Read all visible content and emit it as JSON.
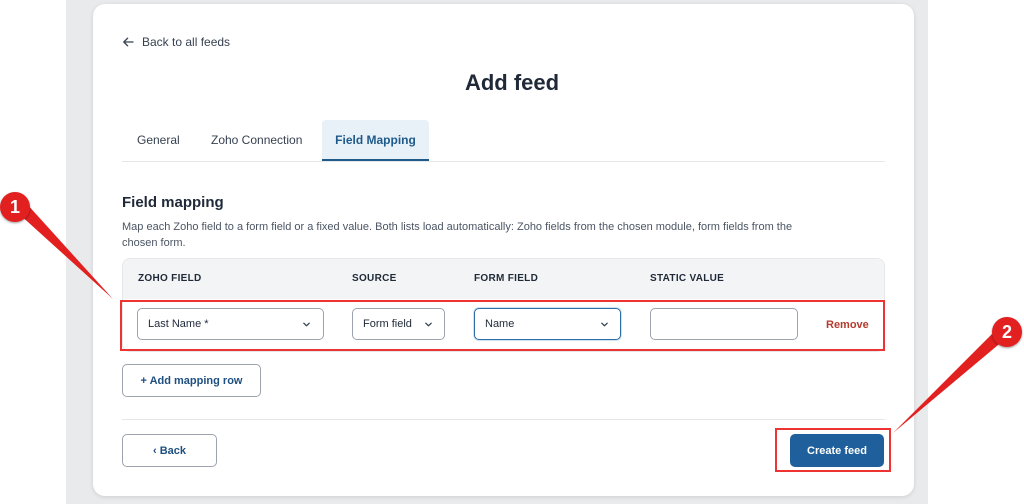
{
  "nav": {
    "back_label": "Back to all feeds"
  },
  "page": {
    "title": "Add feed"
  },
  "tabs": [
    {
      "label": "General",
      "active": false
    },
    {
      "label": "Zoho Connection",
      "active": false
    },
    {
      "label": "Field Mapping",
      "active": true
    }
  ],
  "section": {
    "title": "Field mapping",
    "description": "Map each Zoho field to a form field or a fixed value. Both lists load automatically: Zoho fields from the chosen module, form fields from the chosen form."
  },
  "table": {
    "headers": [
      "ZOHO FIELD",
      "SOURCE",
      "FORM FIELD",
      "STATIC VALUE"
    ],
    "rows": [
      {
        "zoho_field": "Last Name *",
        "source": "Form field",
        "form_field": "Name",
        "static_value": "",
        "remove_label": "Remove"
      }
    ]
  },
  "actions": {
    "add_row_label": "+ Add mapping row",
    "back_label": "‹ Back",
    "create_label": "Create feed"
  },
  "annotations": {
    "marker_1": "1",
    "marker_2": "2",
    "color": "#e32020"
  },
  "icons": {
    "back": "arrow-left-icon",
    "select": "chevron-down-icon"
  }
}
